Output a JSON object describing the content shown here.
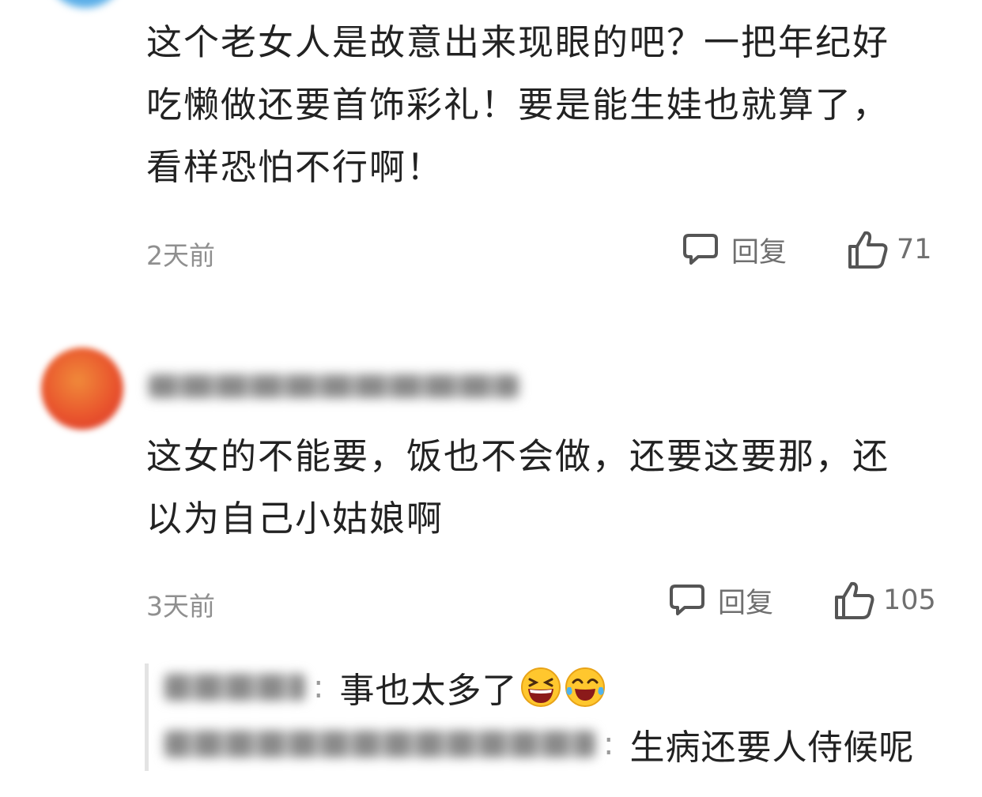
{
  "comments": [
    {
      "text_lines": [
        "这个老女人是故意出来现眼的吧？一把年纪好",
        "吃懒做还要首饰彩礼！要是能生娃也就算了，",
        "看样恐怕不行啊！"
      ],
      "time": "2天前",
      "reply_label": "回复",
      "likes": "71"
    },
    {
      "text_lines": [
        "这女的不能要，饭也不会做，还要这要那，还",
        "以为自己小姑娘啊"
      ],
      "time": "3天前",
      "reply_label": "回复",
      "likes": "105"
    }
  ],
  "subreplies": [
    {
      "colon": ":",
      "text": "事也太多了",
      "emojis": [
        "grinning-squint-emoji",
        "tears-of-joy-emoji"
      ]
    },
    {
      "colon": ":",
      "text": "生病还要人侍候呢"
    }
  ],
  "colors": {
    "text": "#222222",
    "meta": "#8f8f8f",
    "action": "#6f6f6f",
    "subreply_border": "#e3e3e3",
    "avatar_top": "#5aaee8",
    "avatar_second": "#e9552d"
  },
  "icons": [
    "comment-bubble-icon",
    "thumbs-up-icon"
  ]
}
